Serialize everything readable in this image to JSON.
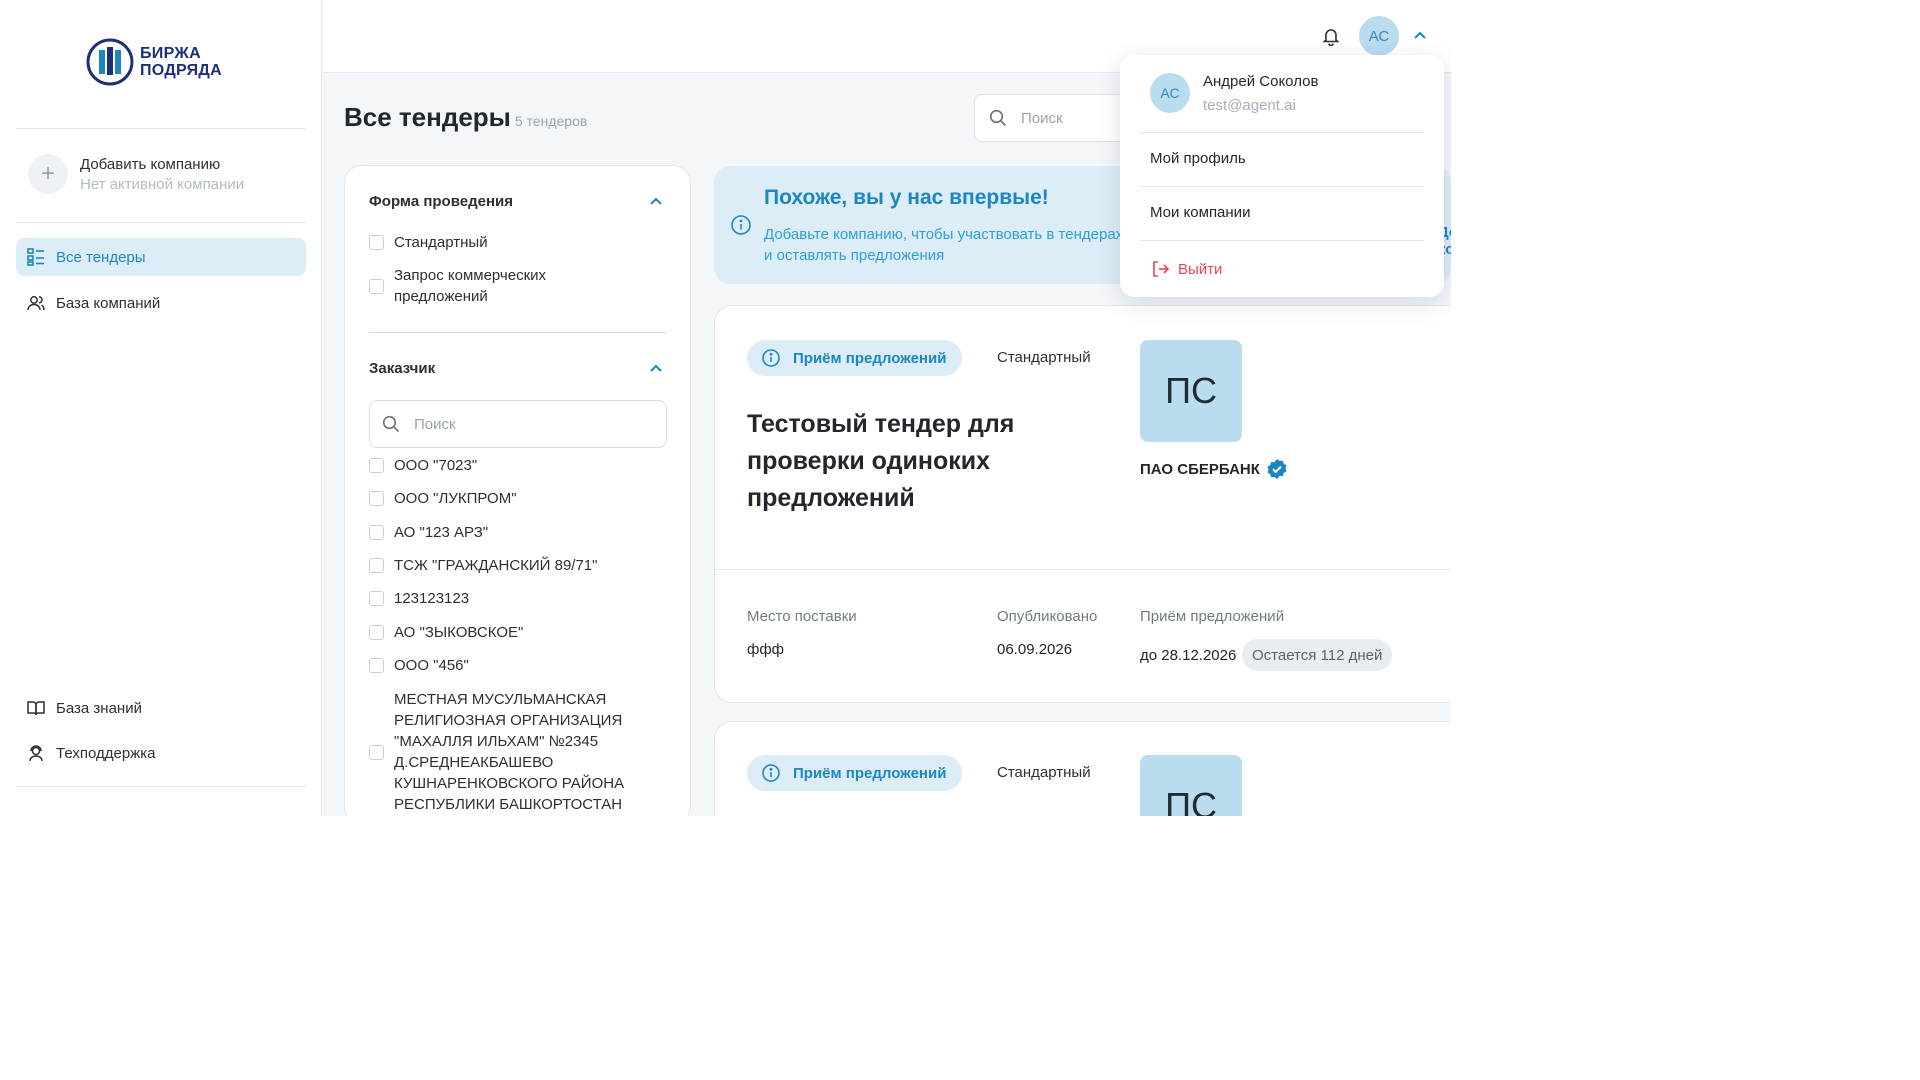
{
  "logo": {
    "line1": "БИРЖА",
    "line2": "ПОДРЯДА"
  },
  "sidebar": {
    "add_company": {
      "title": "Добавить компанию",
      "subtitle": "Нет активной компании"
    },
    "nav": [
      {
        "label": "Все тендеры",
        "icon": "list-icon",
        "active": true
      },
      {
        "label": "База компаний",
        "icon": "users-icon"
      }
    ],
    "bottom_nav": [
      {
        "label": "База знаний",
        "icon": "book-icon"
      },
      {
        "label": "Техподдержка",
        "icon": "support-icon"
      }
    ]
  },
  "header": {
    "avatar_initials": "АС"
  },
  "page": {
    "title": "Все тендеры",
    "count": "5 тендеров",
    "search_placeholder": "Поиск"
  },
  "filters": {
    "form": {
      "title": "Форма проведения",
      "options": [
        "Стандартный",
        "Запрос коммерческих предложений"
      ]
    },
    "customer": {
      "title": "Заказчик",
      "search_placeholder": "Поиск",
      "options": [
        "ООО \"7023\"",
        "ООО \"ЛУКПРОМ\"",
        "АО \"123 АРЗ\"",
        "ТСЖ \"ГРАЖДАНСКИЙ 89/71\"",
        "123123123",
        "АО \"ЗЫКОВСКОЕ\"",
        "ООО \"456\"",
        "МЕСТНАЯ МУСУЛЬМАНСКАЯ РЕЛИГИОЗНАЯ ОРГАНИЗАЦИЯ \"МАХАЛЛЯ ИЛЬХАМ\" №2345 Д.СРЕДНЕАКБАШЕВО КУШНАРЕНКОВСКОГО РАЙОНА РЕСПУБЛИКИ БАШКОРТОСТАН"
      ]
    }
  },
  "banner": {
    "title": "Похоже, вы у нас впервые!",
    "text": "Добавьте компанию, чтобы участвовать в тендерах и оставлять предложения",
    "link": "Добавить компанию"
  },
  "tenders": [
    {
      "status": "Приём предложений",
      "form": "Стандартный",
      "title": "Тестовый тендер для проверки одиноких предложений",
      "customer_initials": "ПС",
      "customer_name": "ПАО СБЕРБАНК",
      "place_label": "Место поставки",
      "place": "ффф",
      "published_label": "Опубликовано",
      "published": "06.09.2026",
      "deadline_label": "Приём предложений",
      "deadline": "до 28.12.2026",
      "days_left": "Остается 112 дней"
    },
    {
      "status": "Приём предложений",
      "form": "Стандартный",
      "customer_initials": "ПС"
    }
  ],
  "user_menu": {
    "initials": "АС",
    "name": "Андрей Соколов",
    "email": "test@agent.ai",
    "items": [
      "Мой профиль",
      "Мои компании"
    ],
    "logout": "Выйти"
  },
  "colors": {
    "accent": "#1b87c2",
    "accent_light": "#dcedf8",
    "avatar_bg": "#b9dcef",
    "danger": "#e5484d"
  }
}
